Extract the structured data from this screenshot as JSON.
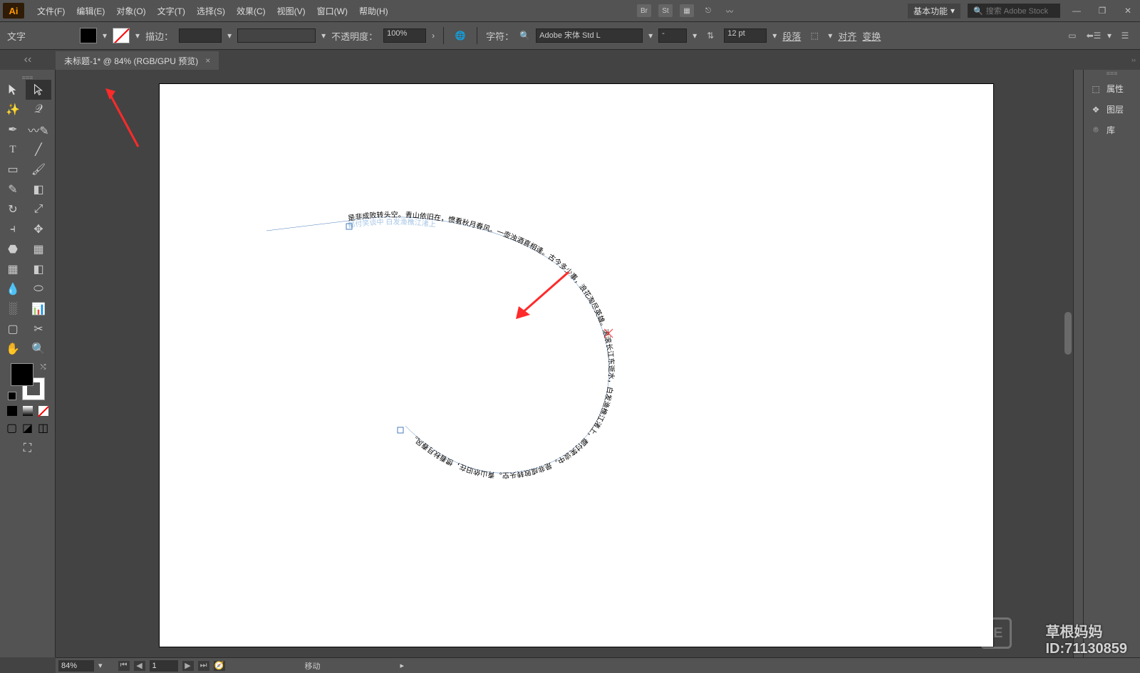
{
  "app": {
    "logo": "Ai"
  },
  "menu": {
    "file": "文件(F)",
    "edit": "编辑(E)",
    "object": "对象(O)",
    "type": "文字(T)",
    "select": "选择(S)",
    "effect": "效果(C)",
    "view": "视图(V)",
    "window": "窗口(W)",
    "help": "帮助(H)"
  },
  "menubar_right": {
    "br": "Br",
    "st": "St",
    "workspace": "基本功能",
    "search_placeholder": "搜索 Adobe Stock"
  },
  "control": {
    "tool_label": "文字",
    "stroke_label": "描边：",
    "stroke_value": "",
    "opacity_label": "不透明度：",
    "opacity_value": "100%",
    "char_label": "字符：",
    "font_name": "Adobe 宋体 Std L",
    "font_style": "-",
    "font_size": "12 pt",
    "para_label": "段落",
    "align_label": "对齐",
    "transform_label": "变换"
  },
  "tab": {
    "title": "未标题-1* @ 84% (RGB/GPU 预览)",
    "close": "×"
  },
  "right_panel": {
    "properties": "属性",
    "layers": "图层",
    "libraries": "库"
  },
  "status": {
    "zoom": "84%",
    "artboard_num": "1",
    "tool_hint": "移动"
  },
  "watermark": {
    "line1": "草根妈妈",
    "line2": "ID:71130859",
    "icon": "IE"
  },
  "canvas": {
    "path_text_outer": "是非成败转头空。青山依旧在，惯看秋月春风。一壶浊酒喜相逢。古今多少事，浪花淘尽英雄。滚滚长江东逝水，白发渔樵江渚上，都付笑谈中。是非成败转头空。青山依旧在，惯看秋月春风。",
    "path_text_inner": "都付笑谈中 白发渔樵江渚上"
  }
}
